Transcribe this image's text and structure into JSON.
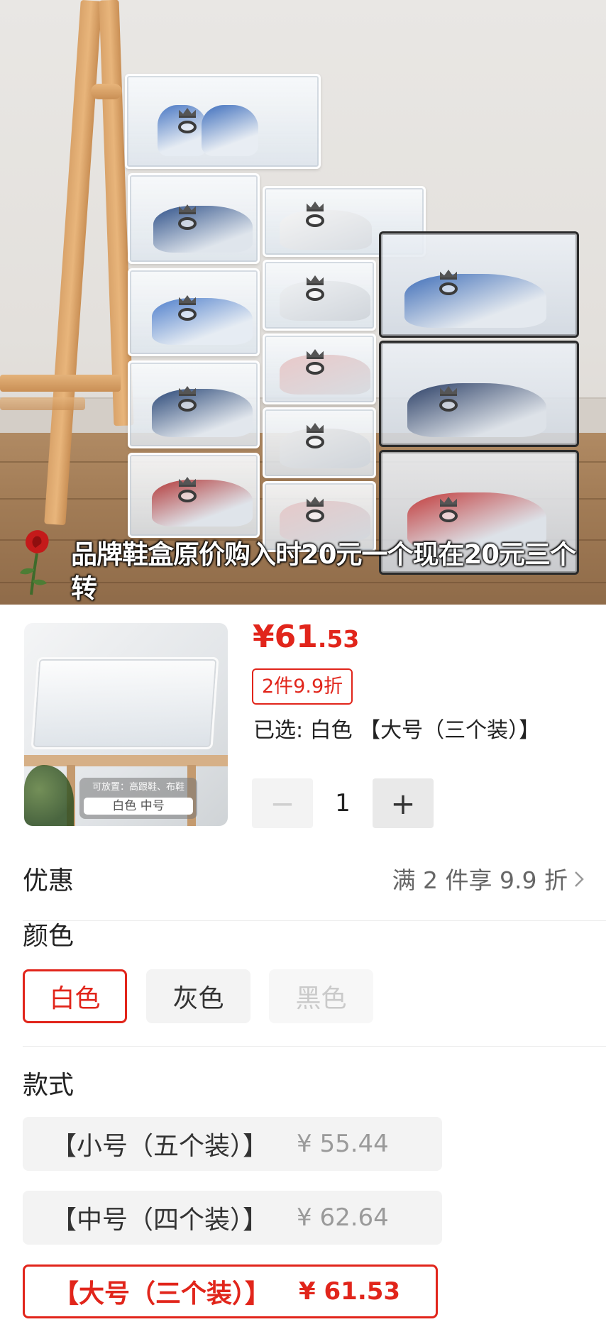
{
  "video": {
    "caption": "品牌鞋盒原价购入时20元一个现在20元三个转"
  },
  "product": {
    "thumbnail": {
      "label_small": "可放置：高跟鞋、布鞋",
      "label_variant": "白色 中号"
    },
    "price": {
      "symbol": "¥",
      "integer": "61",
      "decimal": ".53"
    },
    "discount_tag": "2件9.9折",
    "selected_text": "已选: 白色 【大号（三个装）】",
    "quantity": {
      "minus": "−",
      "value": "1",
      "plus": "+"
    }
  },
  "promo": {
    "label": "优惠",
    "value": "满 2 件享 9.9 折",
    "chevron_icon": "chevron-right-icon"
  },
  "color_section": {
    "title": "颜色",
    "options": [
      {
        "label": "白色",
        "state": "active"
      },
      {
        "label": "灰色",
        "state": "normal"
      },
      {
        "label": "黑色",
        "state": "disabled"
      }
    ]
  },
  "style_section": {
    "title": "款式",
    "options": [
      {
        "label": "【小号（五个装）】",
        "price": "¥ 55.44",
        "state": "normal"
      },
      {
        "label": "【中号（四个装）】",
        "price": "¥ 62.64",
        "state": "normal"
      },
      {
        "label": "【大号（三个装）】",
        "price": "¥ 61.53",
        "state": "active"
      }
    ]
  },
  "colors": {
    "accent_red": "#e1251b",
    "chip_gray": "#f3f3f3",
    "muted_text": "#9a9a9a"
  }
}
